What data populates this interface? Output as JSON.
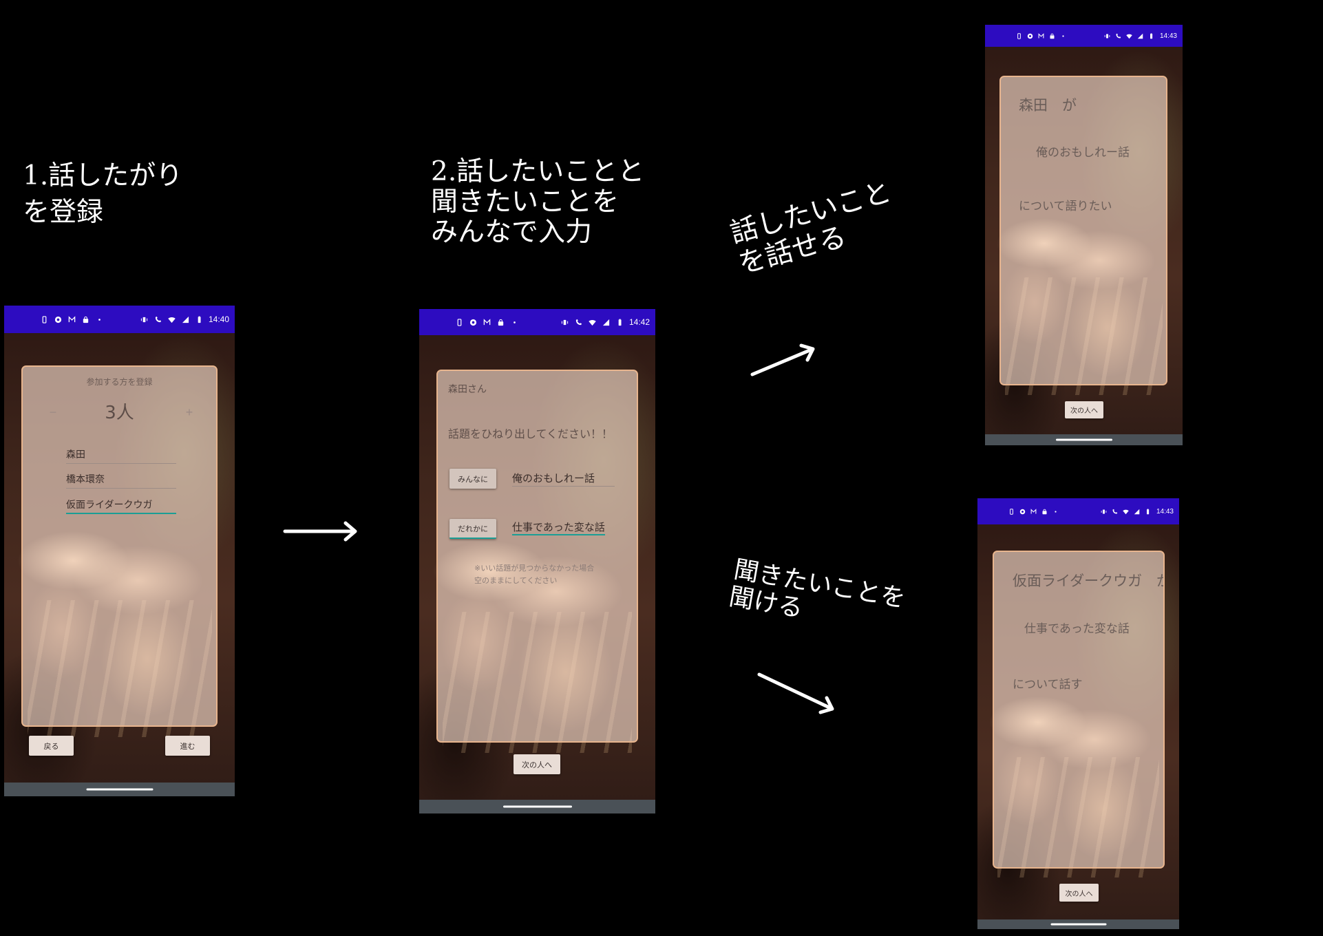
{
  "captions": {
    "register": {
      "line1": "1.話したがり",
      "line2": "を登録"
    },
    "input_topics": {
      "line1": "2.話したいことと",
      "line2": "聞きたいことを",
      "line3": "みんなで入力"
    },
    "talk": {
      "line1": "話したいこと",
      "line2": "を話せる"
    },
    "listen": {
      "line1": "聞きたいことを",
      "line2": "聞ける"
    }
  },
  "status_bar": {
    "left_icons": [
      "screenshot-icon",
      "app-icon",
      "mail-icon",
      "bag-icon",
      "dot-icon"
    ],
    "right_icons": [
      "vibrate-icon",
      "wifi-call-icon",
      "wifi-icon",
      "signal-icon",
      "battery-icon"
    ]
  },
  "screens": {
    "register": {
      "time": "14:40",
      "heading": "参加する方を登録",
      "minus": "−",
      "count": "3人",
      "plus": "+",
      "participants": [
        "森田",
        "橋本環奈",
        "仮面ライダークウガ"
      ],
      "back_label": "戻る",
      "next_label": "進む"
    },
    "topic_entry": {
      "time": "14:42",
      "speaker": "森田さん",
      "prompt": "話題をひねり出してください！！",
      "everyone_button": "みんなに",
      "everyone_topic": "俺のおもしれー話",
      "someone_button": "だれかに",
      "someone_topic": "仕事であった変な話",
      "note_line1": "※いい話題が見つからなかった場合",
      "note_line2": "空のままにしてください",
      "next_person": "次の人へ"
    },
    "talk_result": {
      "time": "14:43",
      "speaker": "森田　が",
      "topic": "俺のおもしれー話",
      "action": "について語りたい",
      "next_person": "次の人へ"
    },
    "listen_result": {
      "time": "14:43",
      "speaker": "仮面ライダークウガ　が",
      "topic": "仕事であった変な話",
      "action": "について話す",
      "next_person": "次の人へ"
    }
  },
  "colors": {
    "status_bar": "#2d0cc0",
    "accent": "#1a9e95",
    "card_border": "#e8b58e",
    "nav_bar": "#4a5157"
  }
}
